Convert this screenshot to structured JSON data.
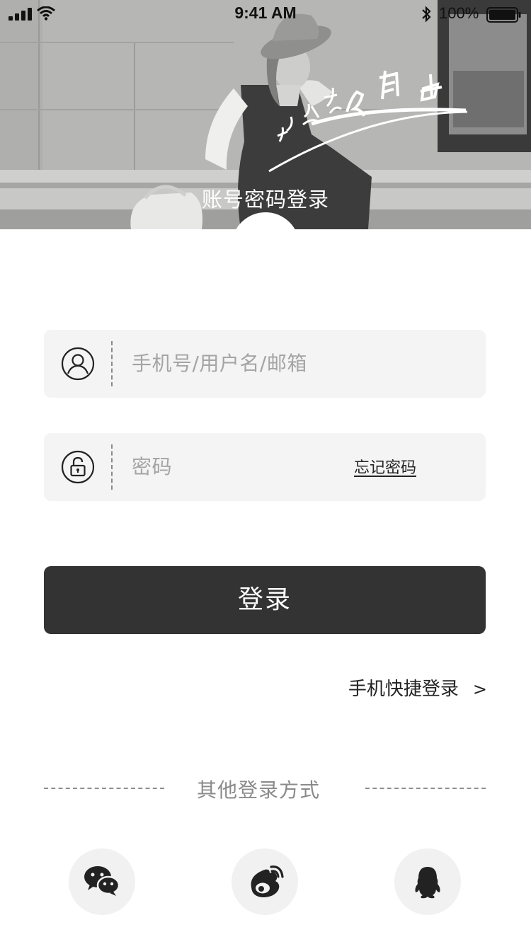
{
  "status_bar": {
    "time": "9:41 AM",
    "battery": "100%"
  },
  "hero": {
    "title": "账号密码登录",
    "slogan_art": "让穿搭更简单"
  },
  "form": {
    "username_placeholder": "手机号/用户名/邮箱",
    "password_placeholder": "密码",
    "forgot_password": "忘记密码",
    "login_button": "登录"
  },
  "quick_login": {
    "label": "手机快捷登录",
    "arrow": ">"
  },
  "other_login": {
    "title": "其他登录方式",
    "providers": [
      "wechat-icon",
      "weibo-icon",
      "qq-icon"
    ]
  },
  "colors": {
    "button": "#333333",
    "field_bg": "#f4f4f4",
    "placeholder": "#a4a4a4",
    "muted": "#8a8a8a",
    "social_bg": "#f1f1f1"
  }
}
